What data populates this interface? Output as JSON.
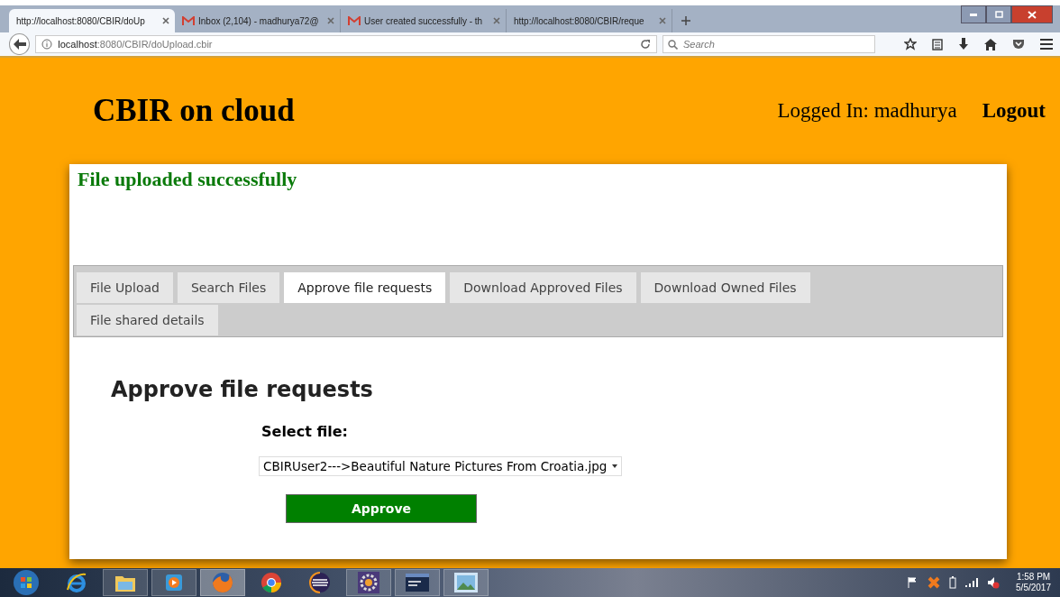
{
  "browser": {
    "tabs": [
      {
        "title": "http://localhost:8080/CBIR/doUp",
        "kind": "page",
        "selected": true
      },
      {
        "title": "Inbox (2,104) - madhurya72@",
        "kind": "mail",
        "selected": false
      },
      {
        "title": "User created successfully - th",
        "kind": "mail",
        "selected": false
      },
      {
        "title": "http://localhost:8080/CBIR/reque",
        "kind": "page",
        "selected": false
      }
    ],
    "address": {
      "host": "localhost",
      "path": ":8080/CBIR/doUpload.cbir"
    },
    "search": {
      "placeholder": "Search"
    }
  },
  "page": {
    "site_title": "CBIR on cloud",
    "user_label": "Logged In: madhurya",
    "logout": "Logout",
    "message": "File uploaded successfully",
    "tabs": [
      {
        "label": "File Upload",
        "selected": false
      },
      {
        "label": "Search Files",
        "selected": false
      },
      {
        "label": "Approve file requests",
        "selected": true
      },
      {
        "label": "Download Approved Files",
        "selected": false
      },
      {
        "label": "Download Owned Files",
        "selected": false
      },
      {
        "label": "File shared details",
        "selected": false
      }
    ],
    "heading": "Approve file requests",
    "select_label": "Select file:",
    "select_value": "CBIRUser2--->Beautiful Nature Pictures From Croatia.jpg",
    "button": "Approve"
  },
  "taskbar": {
    "time": "1:58 PM",
    "date": "5/5/2017"
  }
}
